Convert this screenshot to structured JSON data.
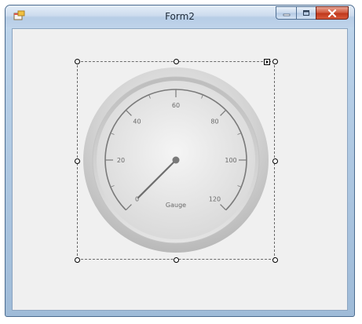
{
  "window": {
    "title": "Form2",
    "app_icon": "form-app-icon",
    "caption_buttons": [
      "minimize-icon",
      "maximize-icon",
      "close-icon"
    ]
  },
  "gauge": {
    "scale_labels": [
      "0",
      "20",
      "40",
      "60",
      "80",
      "100",
      "120"
    ],
    "caption": "Gauge",
    "value": 0,
    "colors": {
      "bezel": "#c8c8c8",
      "face": "#e6e6e6",
      "scale": "#7a7a7a",
      "needle": "#6f6f6f"
    }
  },
  "designer": {
    "smart_tag_icon": "smart-tag-arrow-icon"
  }
}
